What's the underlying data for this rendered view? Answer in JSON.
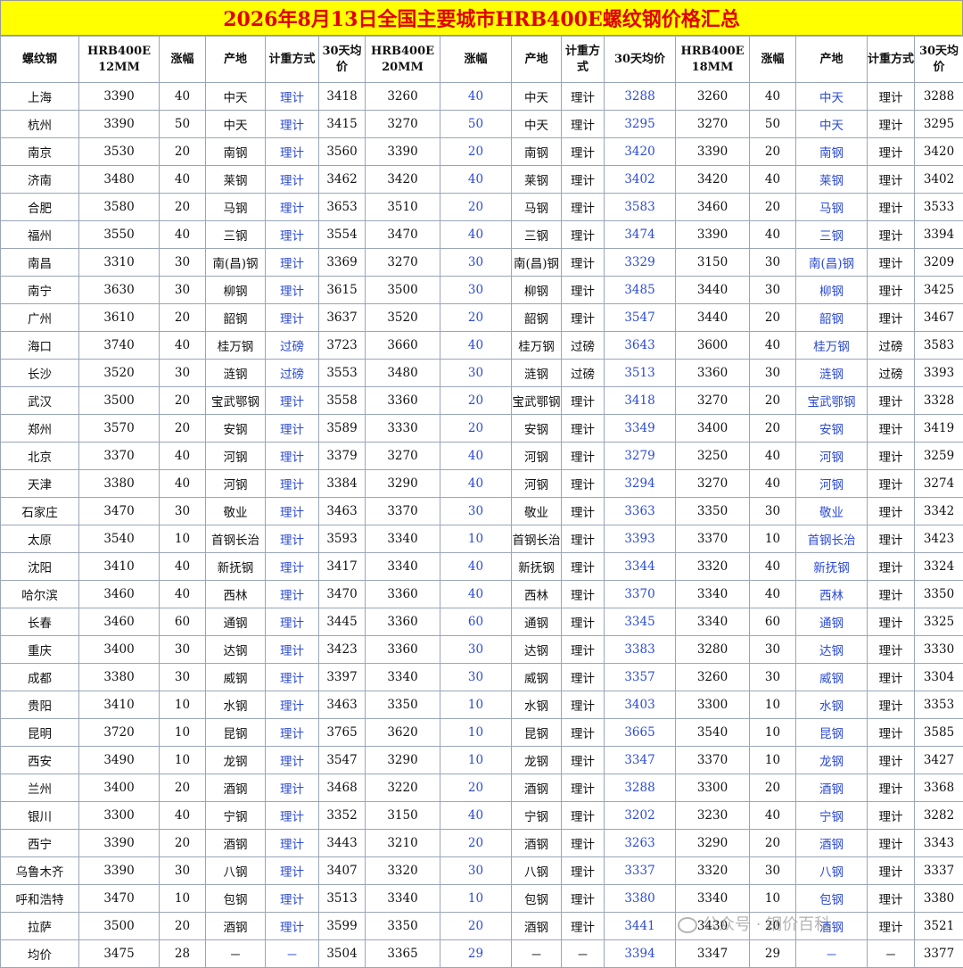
{
  "title": "2026年8月13日全国主要城市HRB400E螺纹钢价格汇总",
  "headers": [
    "螺纹钢",
    "HRB400E 12MM",
    "涨幅",
    "产地",
    "计重方式",
    "30天均价",
    "HRB400E 20MM",
    "涨幅",
    "产地",
    "计重方式",
    "30天均价",
    "HRB400E 18MM",
    "涨幅",
    "产地",
    "计重方式",
    "30天均价"
  ],
  "rows": [
    [
      "上海",
      "3390",
      "40",
      "中天",
      "理计",
      "3418",
      "3260",
      "40",
      "中天",
      "理计",
      "3288",
      "3260",
      "40",
      "中天",
      "理计",
      "3288"
    ],
    [
      "杭州",
      "3390",
      "50",
      "中天",
      "理计",
      "3415",
      "3270",
      "50",
      "中天",
      "理计",
      "3295",
      "3270",
      "50",
      "中天",
      "理计",
      "3295"
    ],
    [
      "南京",
      "3530",
      "20",
      "南钢",
      "理计",
      "3560",
      "3390",
      "20",
      "南钢",
      "理计",
      "3420",
      "3390",
      "20",
      "南钢",
      "理计",
      "3420"
    ],
    [
      "济南",
      "3480",
      "40",
      "莱钢",
      "理计",
      "3462",
      "3420",
      "40",
      "莱钢",
      "理计",
      "3402",
      "3420",
      "40",
      "莱钢",
      "理计",
      "3402"
    ],
    [
      "合肥",
      "3580",
      "20",
      "马钢",
      "理计",
      "3653",
      "3510",
      "20",
      "马钢",
      "理计",
      "3583",
      "3460",
      "20",
      "马钢",
      "理计",
      "3533"
    ],
    [
      "福州",
      "3550",
      "40",
      "三钢",
      "理计",
      "3554",
      "3470",
      "40",
      "三钢",
      "理计",
      "3474",
      "3390",
      "40",
      "三钢",
      "理计",
      "3394"
    ],
    [
      "南昌",
      "3310",
      "30",
      "南(昌)钢",
      "理计",
      "3369",
      "3270",
      "30",
      "南(昌)钢",
      "理计",
      "3329",
      "3150",
      "30",
      "南(昌)钢",
      "理计",
      "3209"
    ],
    [
      "南宁",
      "3630",
      "30",
      "柳钢",
      "理计",
      "3615",
      "3500",
      "30",
      "柳钢",
      "理计",
      "3485",
      "3440",
      "30",
      "柳钢",
      "理计",
      "3425"
    ],
    [
      "广州",
      "3610",
      "20",
      "韶钢",
      "理计",
      "3637",
      "3520",
      "20",
      "韶钢",
      "理计",
      "3547",
      "3440",
      "20",
      "韶钢",
      "理计",
      "3467"
    ],
    [
      "海口",
      "3740",
      "40",
      "桂万钢",
      "过磅",
      "3723",
      "3660",
      "40",
      "桂万钢",
      "过磅",
      "3643",
      "3600",
      "40",
      "桂万钢",
      "过磅",
      "3583"
    ],
    [
      "长沙",
      "3520",
      "30",
      "涟钢",
      "过磅",
      "3553",
      "3480",
      "30",
      "涟钢",
      "过磅",
      "3513",
      "3360",
      "30",
      "涟钢",
      "过磅",
      "3393"
    ],
    [
      "武汉",
      "3500",
      "20",
      "宝武鄂钢",
      "理计",
      "3558",
      "3360",
      "20",
      "宝武鄂钢",
      "理计",
      "3418",
      "3270",
      "20",
      "宝武鄂钢",
      "理计",
      "3328"
    ],
    [
      "郑州",
      "3570",
      "20",
      "安钢",
      "理计",
      "3589",
      "3330",
      "20",
      "安钢",
      "理计",
      "3349",
      "3400",
      "20",
      "安钢",
      "理计",
      "3419"
    ],
    [
      "北京",
      "3370",
      "40",
      "河钢",
      "理计",
      "3379",
      "3270",
      "40",
      "河钢",
      "理计",
      "3279",
      "3250",
      "40",
      "河钢",
      "理计",
      "3259"
    ],
    [
      "天津",
      "3380",
      "40",
      "河钢",
      "理计",
      "3384",
      "3290",
      "40",
      "河钢",
      "理计",
      "3294",
      "3270",
      "40",
      "河钢",
      "理计",
      "3274"
    ],
    [
      "石家庄",
      "3470",
      "30",
      "敬业",
      "理计",
      "3463",
      "3370",
      "30",
      "敬业",
      "理计",
      "3363",
      "3350",
      "30",
      "敬业",
      "理计",
      "3342"
    ],
    [
      "太原",
      "3540",
      "10",
      "首钢长治",
      "理计",
      "3593",
      "3340",
      "10",
      "首钢长治",
      "理计",
      "3393",
      "3370",
      "10",
      "首钢长治",
      "理计",
      "3423"
    ],
    [
      "沈阳",
      "3410",
      "40",
      "新抚钢",
      "理计",
      "3417",
      "3340",
      "40",
      "新抚钢",
      "理计",
      "3344",
      "3320",
      "40",
      "新抚钢",
      "理计",
      "3324"
    ],
    [
      "哈尔滨",
      "3460",
      "40",
      "西林",
      "理计",
      "3470",
      "3360",
      "40",
      "西林",
      "理计",
      "3370",
      "3340",
      "40",
      "西林",
      "理计",
      "3350"
    ],
    [
      "长春",
      "3460",
      "60",
      "通钢",
      "理计",
      "3445",
      "3360",
      "60",
      "通钢",
      "理计",
      "3345",
      "3340",
      "60",
      "通钢",
      "理计",
      "3325"
    ],
    [
      "重庆",
      "3400",
      "30",
      "达钢",
      "理计",
      "3423",
      "3360",
      "30",
      "达钢",
      "理计",
      "3383",
      "3280",
      "30",
      "达钢",
      "理计",
      "3330"
    ],
    [
      "成都",
      "3380",
      "30",
      "威钢",
      "理计",
      "3397",
      "3340",
      "30",
      "威钢",
      "理计",
      "3357",
      "3260",
      "30",
      "威钢",
      "理计",
      "3304"
    ],
    [
      "贵阳",
      "3410",
      "10",
      "水钢",
      "理计",
      "3463",
      "3350",
      "10",
      "水钢",
      "理计",
      "3403",
      "3300",
      "10",
      "水钢",
      "理计",
      "3353"
    ],
    [
      "昆明",
      "3720",
      "10",
      "昆钢",
      "理计",
      "3765",
      "3620",
      "10",
      "昆钢",
      "理计",
      "3665",
      "3540",
      "10",
      "昆钢",
      "理计",
      "3585"
    ],
    [
      "西安",
      "3490",
      "10",
      "龙钢",
      "理计",
      "3547",
      "3290",
      "10",
      "龙钢",
      "理计",
      "3347",
      "3370",
      "10",
      "龙钢",
      "理计",
      "3427"
    ],
    [
      "兰州",
      "3400",
      "20",
      "酒钢",
      "理计",
      "3468",
      "3220",
      "20",
      "酒钢",
      "理计",
      "3288",
      "3300",
      "20",
      "酒钢",
      "理计",
      "3368"
    ],
    [
      "银川",
      "3300",
      "40",
      "宁钢",
      "理计",
      "3352",
      "3150",
      "40",
      "宁钢",
      "理计",
      "3202",
      "3230",
      "40",
      "宁钢",
      "理计",
      "3282"
    ],
    [
      "西宁",
      "3390",
      "20",
      "酒钢",
      "理计",
      "3443",
      "3210",
      "20",
      "酒钢",
      "理计",
      "3263",
      "3290",
      "20",
      "酒钢",
      "理计",
      "3343"
    ],
    [
      "乌鲁木齐",
      "3390",
      "30",
      "八钢",
      "理计",
      "3407",
      "3320",
      "30",
      "八钢",
      "理计",
      "3337",
      "3320",
      "30",
      "八钢",
      "理计",
      "3337"
    ],
    [
      "呼和浩特",
      "3470",
      "10",
      "包钢",
      "理计",
      "3513",
      "3340",
      "10",
      "包钢",
      "理计",
      "3380",
      "3340",
      "10",
      "包钢",
      "理计",
      "3380"
    ],
    [
      "拉萨",
      "3500",
      "20",
      "酒钢",
      "理计",
      "3599",
      "3350",
      "20",
      "酒钢",
      "理计",
      "3441",
      "3430",
      "20",
      "酒钢",
      "理计",
      "3521"
    ],
    [
      "均价",
      "3475",
      "28",
      "－",
      "－",
      "3504",
      "3365",
      "29",
      "－",
      "－",
      "3394",
      "3347",
      "29",
      "－",
      "－",
      "3377"
    ]
  ],
  "watermark": "公众号 · 钢价百科",
  "colors": {
    "title_bg": "#ffff00",
    "title_text": "#e00000",
    "blue_text": "#2b4ad3"
  }
}
